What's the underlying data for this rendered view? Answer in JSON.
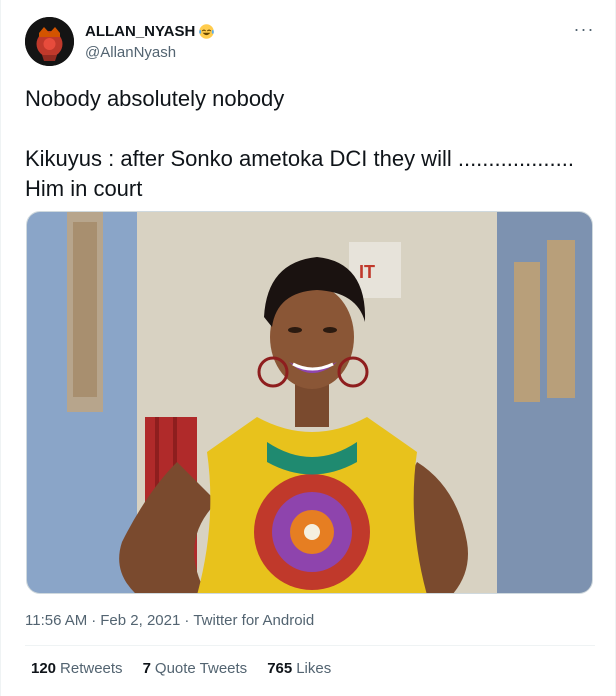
{
  "user": {
    "display_name": "ALLAN_NYASH",
    "handle": "@AllanNyash",
    "emoji": "face-with-tears-of-joy"
  },
  "tweet": {
    "text": "Nobody absolutely nobody\n\nKikuyus : after Sonko ametoka DCI they will  ................... \nHim in court"
  },
  "meta": {
    "time": "11:56 AM",
    "separator1": "·",
    "date": "Feb 2, 2021",
    "separator2": "·",
    "source": "Twitter for Android"
  },
  "stats": {
    "retweets_count": "120",
    "retweets_label": "Retweets",
    "quotes_count": "7",
    "quotes_label": "Quote Tweets",
    "likes_count": "765",
    "likes_label": "Likes"
  },
  "colors": {
    "text_primary": "#0f1419",
    "text_secondary": "#536471",
    "border": "#eff3f4"
  }
}
